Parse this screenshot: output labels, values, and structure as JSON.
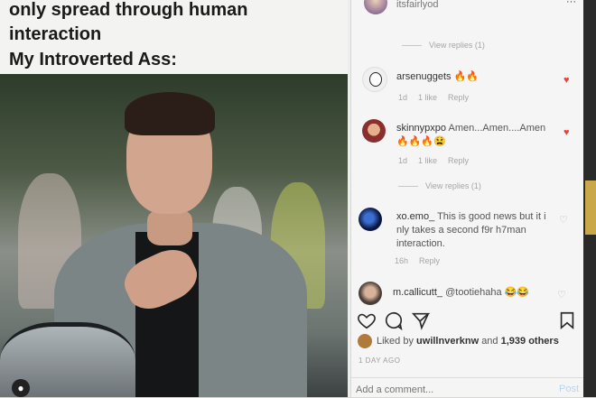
{
  "meme": {
    "line1": "only spread through human",
    "line2": "interaction",
    "line3": "My Introverted Ass:"
  },
  "post": {
    "owner": "itsfairlyod",
    "more_label": "···"
  },
  "comments": [
    {
      "replies_label": "View replies (1)"
    },
    {
      "username": "arsenuggets",
      "text": "🔥🔥",
      "time": "1d",
      "likes": "1 like",
      "reply": "Reply"
    },
    {
      "username": "skinnypxpo",
      "text": "Amen...Amen....Amen",
      "text2": "🔥🔥🔥😫",
      "time": "1d",
      "likes": "1 like",
      "reply": "Reply",
      "replies_label": "View replies (1)"
    },
    {
      "username": "xo.emo_",
      "text": "This is good news but it i nly takes a second f9r h7man interaction.",
      "time": "16h",
      "reply": "Reply"
    },
    {
      "username": "m.callicutt_",
      "text": "@tootiehaha 😂😂"
    }
  ],
  "actions": {
    "like": "heart-icon",
    "comment": "comment-icon",
    "share": "send-icon",
    "save": "bookmark-icon"
  },
  "likes": {
    "prefix": "Liked by",
    "user": "uwillnverknw",
    "suffix": "and",
    "count": "1,939 others"
  },
  "date": "1 DAY AGO",
  "add_comment": {
    "placeholder": "Add a comment...",
    "post": "Post"
  },
  "colors": {
    "heart": "#e8433b",
    "panel": "#f5f5f5"
  }
}
